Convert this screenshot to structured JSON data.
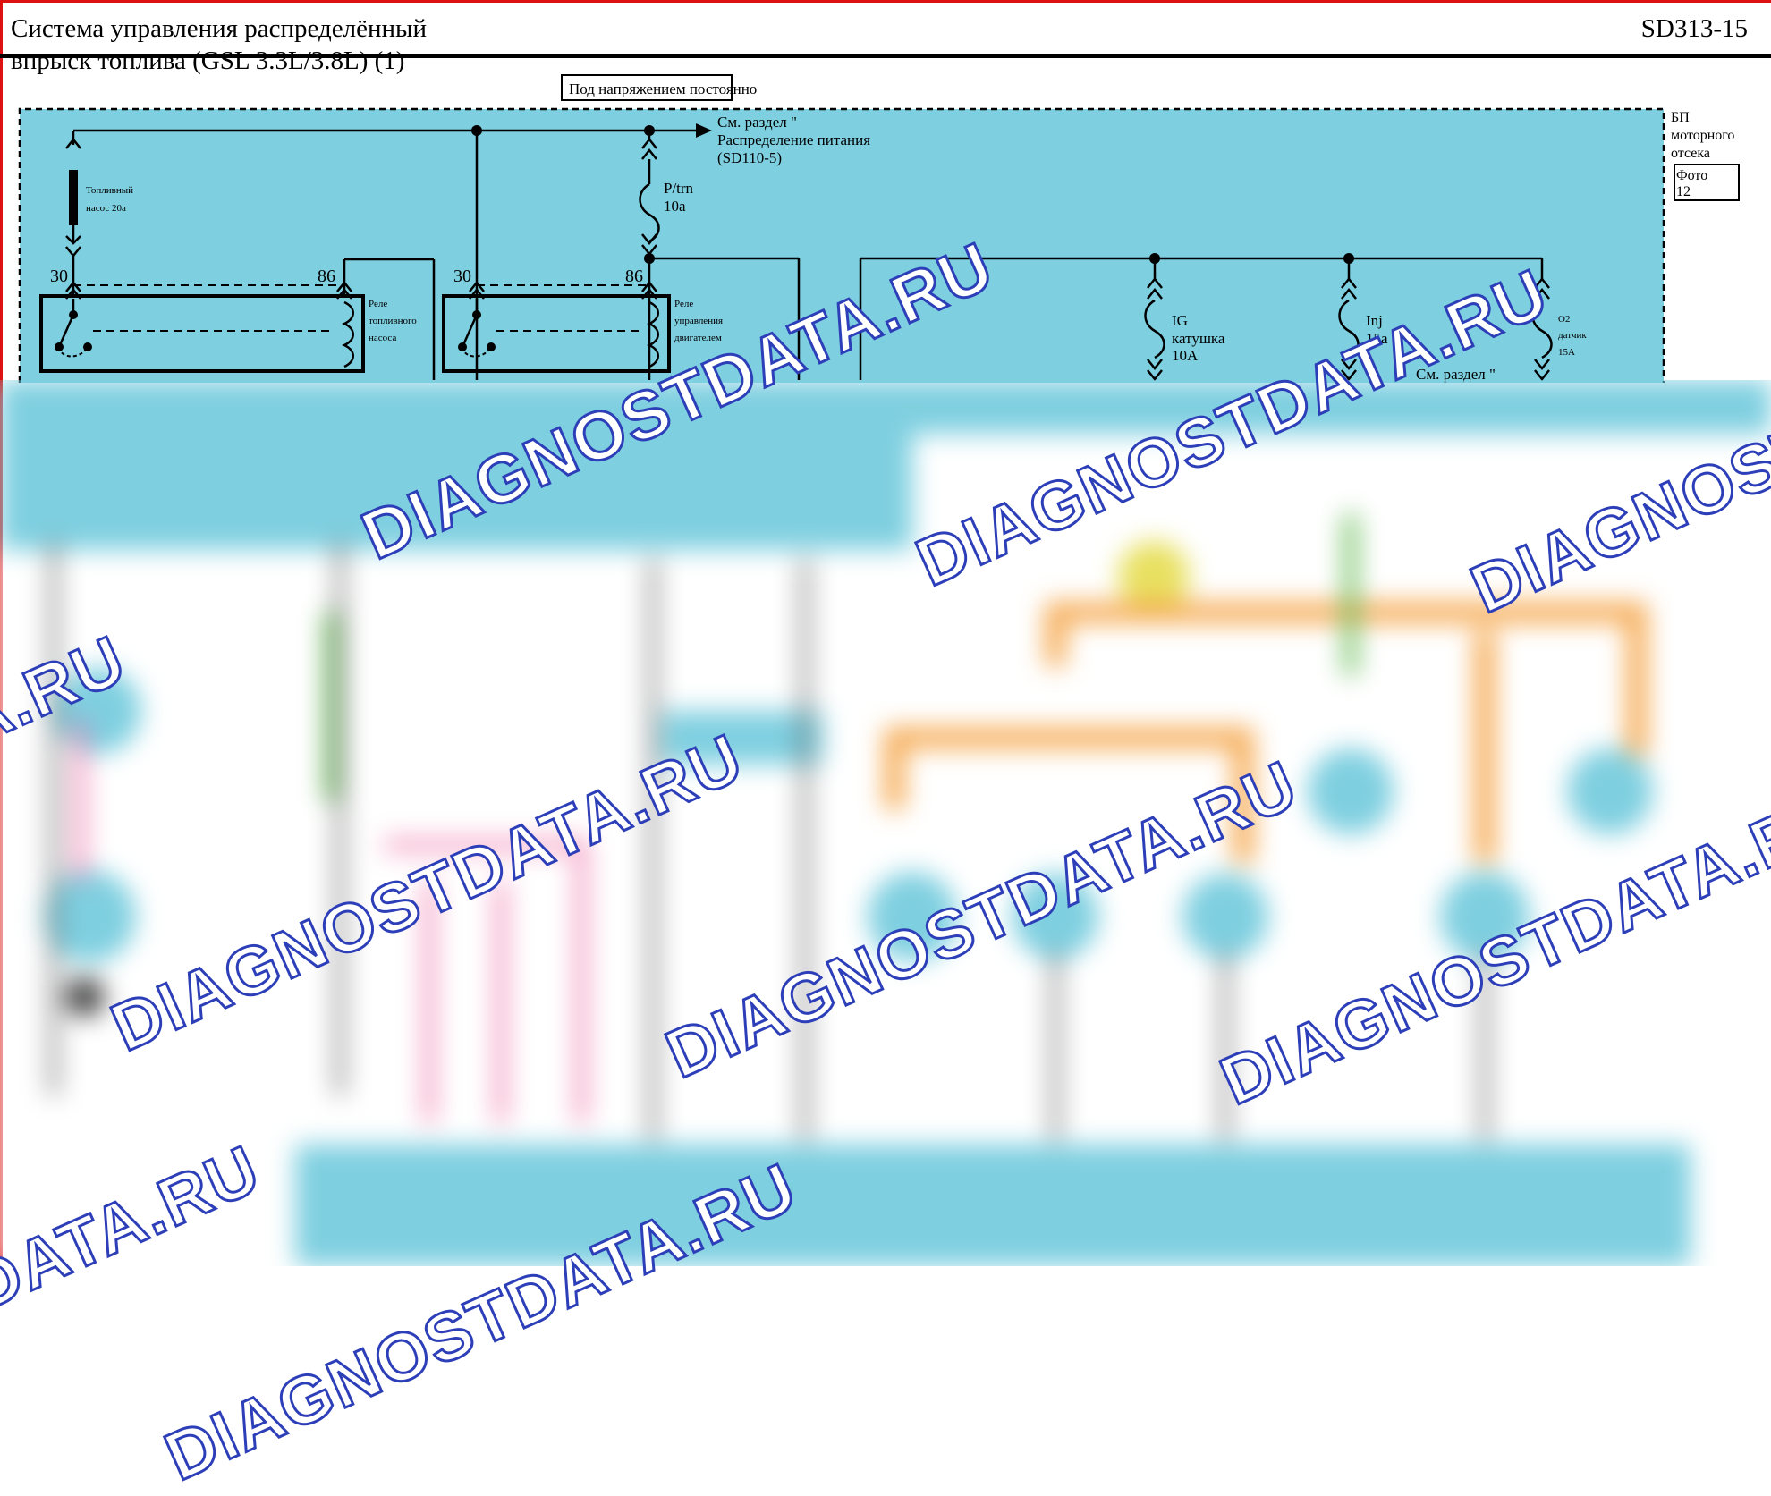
{
  "header": {
    "title": "Система управления распределённый\nвпрыск топлива (GSL 3.3L/3.8L) (1)",
    "page_code": "SD313-15"
  },
  "power_box": {
    "label": "Под напряжением постоянно"
  },
  "reference": {
    "line1": "См. раздел \"",
    "line2": "Распределение питания",
    "line3": "(SD110-5)"
  },
  "side_label": {
    "line1": "БП",
    "line2": "моторного",
    "line3": "отсека",
    "photo_line1": "Фото",
    "photo_line2": "12"
  },
  "fuses": {
    "fuel_pump": {
      "line1": "Топливный",
      "line2": "насос 20a"
    },
    "ptrn": {
      "line1": "P/trn",
      "line2": "10a"
    },
    "ig": {
      "line1": "IG",
      "line2": "катушка",
      "line3": "10A"
    },
    "inj": {
      "line1": "Inj",
      "line2": "15a"
    },
    "o2": {
      "line1": "O2",
      "line2": "датчик",
      "line3": "15A"
    }
  },
  "relays": {
    "fuel_pump": {
      "pin_a": "30",
      "pin_b": "86",
      "line1": "Реле",
      "line2": "топливного",
      "line3": "насоса"
    },
    "engine": {
      "pin_a": "30",
      "pin_b": "86",
      "line1": "Реле",
      "line2": "управления",
      "line3": "двигателем"
    }
  },
  "partial_reference": "См. раздел \"",
  "watermarks": [
    {
      "text": "DIAGNOSTDATA.RU"
    },
    {
      "text": "DIAGNOSTDATA.RU"
    },
    {
      "text": "DIAGNOSTDATA.RU"
    },
    {
      "text": "DIAGNOSTDATA.RU"
    },
    {
      "text": "DIAGNOSTDATA.RU"
    },
    {
      "text": "DIAGNOSTDATA.RU"
    },
    {
      "text": "DIAGNOSTDATA.RU"
    },
    {
      "text": "DIAGNOSTDATA.RU"
    },
    {
      "text": "DIAGNOSTDATA.RU"
    }
  ],
  "colors": {
    "diagram_fill": "#7ecfe0",
    "wire": "#000000",
    "watermark_fill": "#ffffff",
    "watermark_stroke": "#2d3fb8",
    "frame": "#dd1111",
    "wire_orange": "#f5a64a",
    "wire_pink": "#ee6fa5",
    "wire_green": "#66bb55",
    "wire_yellow": "#e8e060"
  }
}
